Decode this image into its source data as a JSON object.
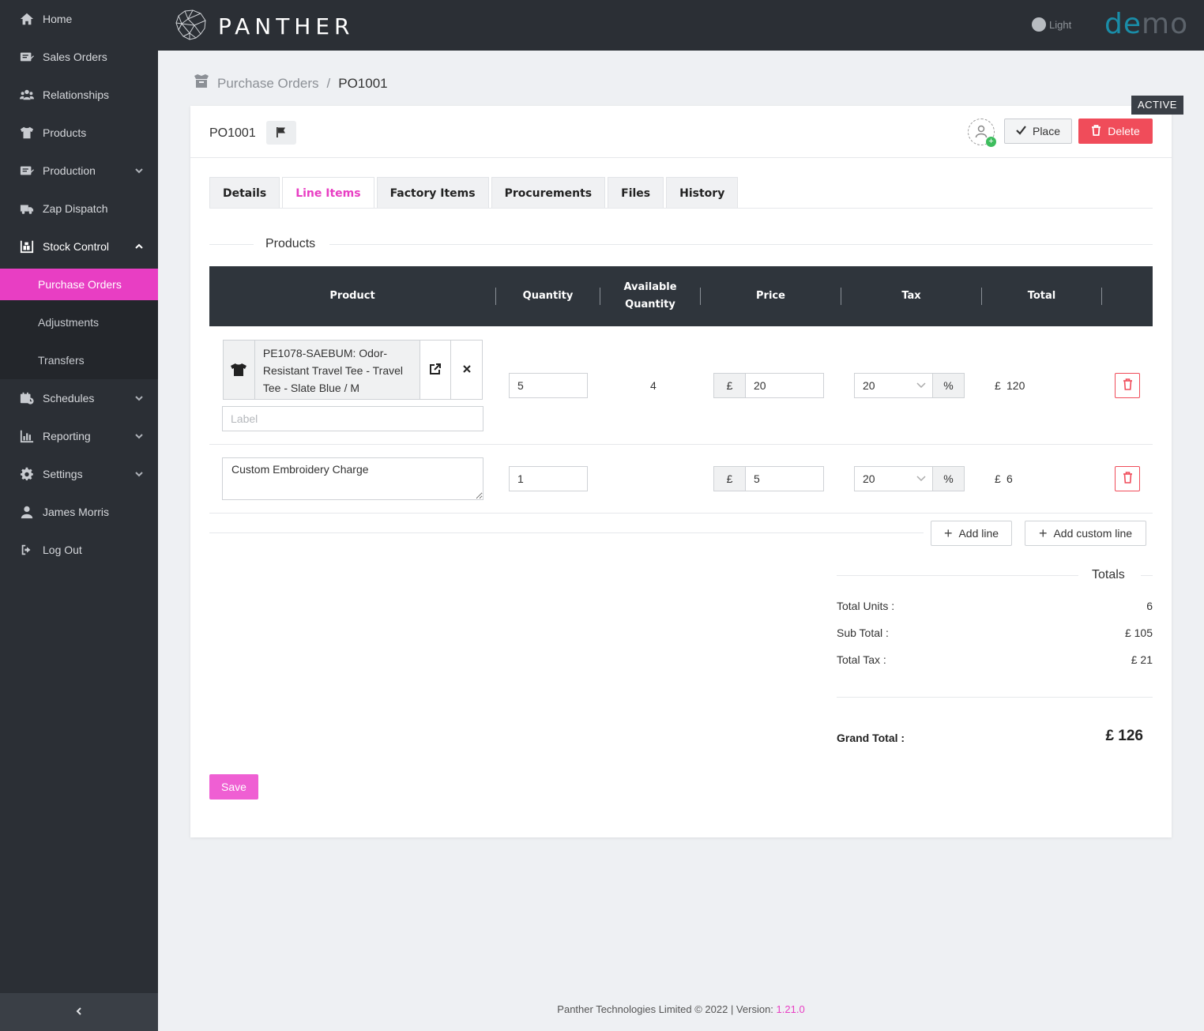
{
  "sidebar": {
    "items": [
      {
        "label": "Home",
        "icon": "home-icon"
      },
      {
        "label": "Sales Orders",
        "icon": "sales-orders-icon"
      },
      {
        "label": "Relationships",
        "icon": "users-icon"
      },
      {
        "label": "Products",
        "icon": "tshirt-icon"
      },
      {
        "label": "Production",
        "icon": "production-icon"
      },
      {
        "label": "Zap Dispatch",
        "icon": "truck-icon"
      },
      {
        "label": "Stock Control",
        "icon": "warehouse-icon"
      },
      {
        "label": "Schedules",
        "icon": "calendar-icon"
      },
      {
        "label": "Reporting",
        "icon": "chart-icon"
      },
      {
        "label": "Settings",
        "icon": "gear-icon"
      },
      {
        "label": "James Morris",
        "icon": "user-icon"
      },
      {
        "label": "Log Out",
        "icon": "logout-icon"
      }
    ],
    "stock_control_children": [
      {
        "label": "Purchase Orders"
      },
      {
        "label": "Adjustments"
      },
      {
        "label": "Transfers"
      }
    ]
  },
  "topbar": {
    "logo_text": "PANTHER",
    "theme_label": "Light",
    "brand_part1": "de",
    "brand_part2": "mo"
  },
  "breadcrumb": {
    "parent": "Purchase Orders",
    "separator": "/",
    "current": "PO1001"
  },
  "order": {
    "number": "PO1001",
    "status": "ACTIVE",
    "place_label": "Place",
    "delete_label": "Delete"
  },
  "tabs": [
    {
      "label": "Details"
    },
    {
      "label": "Line Items"
    },
    {
      "label": "Factory Items"
    },
    {
      "label": "Procurements"
    },
    {
      "label": "Files"
    },
    {
      "label": "History"
    }
  ],
  "section_title": "Products",
  "table": {
    "headers": {
      "product": "Product",
      "quantity": "Quantity",
      "available_1": "Available",
      "available_2": "Quantity",
      "price": "Price",
      "tax": "Tax",
      "total": "Total"
    },
    "rows": [
      {
        "product": "PE1078-SAEBUM: Odor-Resistant Travel Tee - Travel Tee - Slate Blue / M",
        "label_placeholder": "Label",
        "quantity": "5",
        "available": "4",
        "currency": "£",
        "price": "20",
        "tax": "20",
        "tax_unit": "%",
        "total_currency": "£",
        "total": "120"
      },
      {
        "product": "Custom Embroidery Charge",
        "quantity": "1",
        "available": "",
        "currency": "£",
        "price": "5",
        "tax": "20",
        "tax_unit": "%",
        "total_currency": "£",
        "total": "6"
      }
    ],
    "add_line_label": "Add line",
    "add_custom_line_label": "Add custom line"
  },
  "totals": {
    "title": "Totals",
    "units_label": "Total Units :",
    "units_value": "6",
    "subtotal_label": "Sub Total :",
    "subtotal_value": "£ 105",
    "tax_label": "Total Tax :",
    "tax_value": "£ 21",
    "grand_label": "Grand Total :",
    "grand_value": "£ 126"
  },
  "save_label": "Save",
  "footer": {
    "text": "Panther Technologies Limited © 2022 | Version: ",
    "version": "1.21.0"
  },
  "colors": {
    "accent": "#e83ec3",
    "sidebar_bg": "#2b2f35",
    "danger": "#f04c5a",
    "brand_teal": "#1a8da8"
  }
}
